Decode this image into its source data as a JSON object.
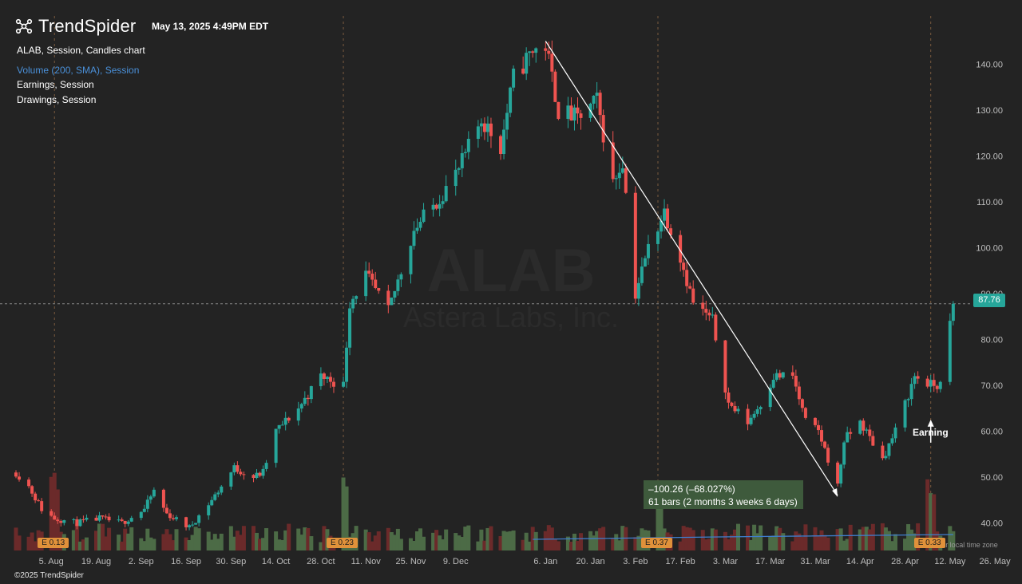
{
  "header": {
    "brand_name": "TrendSpider",
    "timestamp": "May 13, 2025 4:49PM EDT",
    "legend": [
      "ALAB, Session, Candles chart",
      "Volume (200, SMA), Session",
      "Earnings, Session",
      "Drawings, Session"
    ],
    "watermark_symbol": "ALAB",
    "watermark_name": "Astera Labs, Inc."
  },
  "footer": {
    "copyright": "©2025 TrendSpider",
    "timezone_label": "Your local time zone"
  },
  "colors": {
    "background": "#232323",
    "up": "#26a69a",
    "down": "#ef5350",
    "vol_up": "#4c6b46",
    "vol_down": "#6b2a2a",
    "sma": "#3f7fd0",
    "earnings": "#e0913a",
    "grid_marker": "#7a5a3e"
  },
  "icons": [
    "trendspider-logo-icon",
    "arrow-up-icon"
  ],
  "chart_data": {
    "type": "candlestick",
    "symbol": "ALAB",
    "last_price": "87.76",
    "y_ticks": [
      "40.00",
      "50.00",
      "60.00",
      "70.00",
      "80.00",
      "90.00",
      "100.00",
      "110.00",
      "120.00",
      "130.00",
      "140.00"
    ],
    "x_ticks": [
      "5. Aug",
      "19. Aug",
      "2. Sep",
      "16. Sep",
      "30. Sep",
      "14. Oct",
      "28. Oct",
      "11. Nov",
      "25. Nov",
      "9. Dec",
      "6. Jan",
      "20. Jan",
      "3. Feb",
      "17. Feb",
      "3. Mar",
      "17. Mar",
      "31. Mar",
      "14. Apr",
      "28. Apr",
      "12. May",
      "26. May"
    ],
    "ylim": [
      34,
      147
    ],
    "path_closes": [
      {
        "date": "2024-07-25",
        "close": 51
      },
      {
        "date": "2024-07-29",
        "close": 48
      },
      {
        "date": "2024-08-02",
        "close": 43
      },
      {
        "date": "2024-08-06",
        "close": 41
      },
      {
        "date": "2024-08-13",
        "close": 40
      },
      {
        "date": "2024-08-20",
        "close": 41
      },
      {
        "date": "2024-08-27",
        "close": 40
      },
      {
        "date": "2024-09-03",
        "close": 43
      },
      {
        "date": "2024-09-06",
        "close": 47
      },
      {
        "date": "2024-09-10",
        "close": 42
      },
      {
        "date": "2024-09-17",
        "close": 39
      },
      {
        "date": "2024-09-24",
        "close": 45
      },
      {
        "date": "2024-10-01",
        "close": 52
      },
      {
        "date": "2024-10-07",
        "close": 50
      },
      {
        "date": "2024-10-10",
        "close": 51
      },
      {
        "date": "2024-10-14",
        "close": 60
      },
      {
        "date": "2024-10-21",
        "close": 65
      },
      {
        "date": "2024-10-28",
        "close": 72
      },
      {
        "date": "2024-11-04",
        "close": 70
      },
      {
        "date": "2024-11-06",
        "close": 88
      },
      {
        "date": "2024-11-11",
        "close": 94
      },
      {
        "date": "2024-11-18",
        "close": 86
      },
      {
        "date": "2024-11-22",
        "close": 95
      },
      {
        "date": "2024-11-26",
        "close": 104
      },
      {
        "date": "2024-12-03",
        "close": 110
      },
      {
        "date": "2024-12-10",
        "close": 117
      },
      {
        "date": "2024-12-17",
        "close": 128
      },
      {
        "date": "2024-12-23",
        "close": 122
      },
      {
        "date": "2024-12-27",
        "close": 137
      },
      {
        "date": "2025-01-02",
        "close": 143
      },
      {
        "date": "2025-01-06",
        "close": 144
      },
      {
        "date": "2025-01-10",
        "close": 130
      },
      {
        "date": "2025-01-16",
        "close": 128
      },
      {
        "date": "2025-01-22",
        "close": 132
      },
      {
        "date": "2025-01-27",
        "close": 114
      },
      {
        "date": "2025-01-30",
        "close": 119
      },
      {
        "date": "2025-02-03",
        "close": 90
      },
      {
        "date": "2025-02-07",
        "close": 100
      },
      {
        "date": "2025-02-12",
        "close": 108
      },
      {
        "date": "2025-02-17",
        "close": 98
      },
      {
        "date": "2025-02-21",
        "close": 88
      },
      {
        "date": "2025-02-27",
        "close": 84
      },
      {
        "date": "2025-03-04",
        "close": 66
      },
      {
        "date": "2025-03-10",
        "close": 62
      },
      {
        "date": "2025-03-14",
        "close": 66
      },
      {
        "date": "2025-03-18",
        "close": 72
      },
      {
        "date": "2025-03-24",
        "close": 72
      },
      {
        "date": "2025-03-28",
        "close": 62
      },
      {
        "date": "2025-04-01",
        "close": 60
      },
      {
        "date": "2025-04-07",
        "close": 48
      },
      {
        "date": "2025-04-09",
        "close": 58
      },
      {
        "date": "2025-04-14",
        "close": 62
      },
      {
        "date": "2025-04-21",
        "close": 54
      },
      {
        "date": "2025-04-25",
        "close": 60
      },
      {
        "date": "2025-05-01",
        "close": 72
      },
      {
        "date": "2025-05-06",
        "close": 70
      },
      {
        "date": "2025-05-09",
        "close": 70
      },
      {
        "date": "2025-05-13",
        "close": 87.76
      }
    ],
    "earnings": [
      {
        "date": "2024-08-06",
        "label": "E 0.13"
      },
      {
        "date": "2024-11-04",
        "label": "E 0.23"
      },
      {
        "date": "2025-02-10",
        "label": "E 0.37"
      },
      {
        "date": "2025-05-06",
        "label": "E 0.33"
      }
    ],
    "trendline": {
      "from": {
        "date": "2025-01-06",
        "price": 145
      },
      "to": {
        "date": "2025-04-07",
        "price": 46
      }
    },
    "measure": {
      "line1": "–100.26 (–68.027%)",
      "line2": "61 bars (2 months 3 weeks 6 days)"
    },
    "annotation": "Earning",
    "volume_sma_label": "Volume (200, SMA)"
  }
}
